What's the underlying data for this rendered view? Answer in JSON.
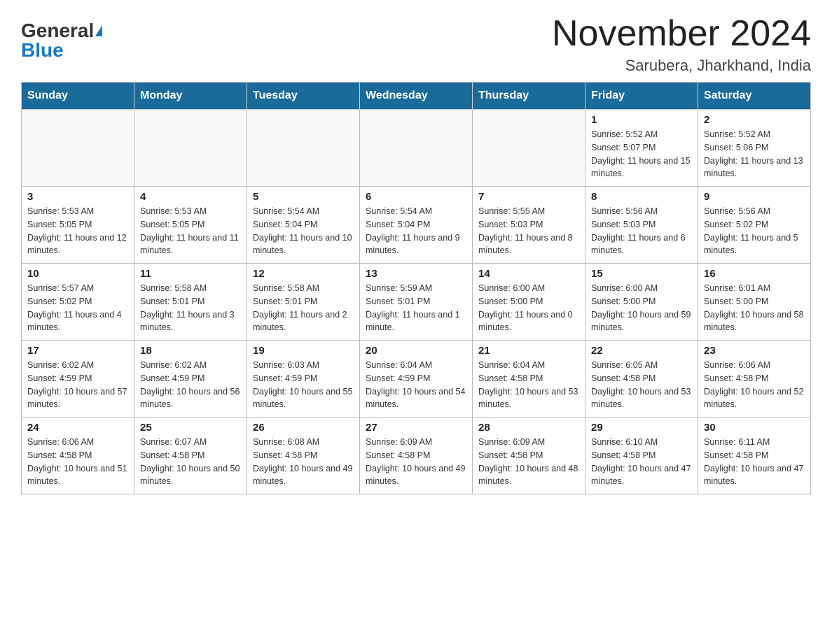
{
  "header": {
    "logo_general": "General",
    "logo_blue": "Blue",
    "month_title": "November 2024",
    "location": "Sarubera, Jharkhand, India"
  },
  "days_of_week": [
    "Sunday",
    "Monday",
    "Tuesday",
    "Wednesday",
    "Thursday",
    "Friday",
    "Saturday"
  ],
  "weeks": [
    [
      {
        "day": "",
        "info": ""
      },
      {
        "day": "",
        "info": ""
      },
      {
        "day": "",
        "info": ""
      },
      {
        "day": "",
        "info": ""
      },
      {
        "day": "",
        "info": ""
      },
      {
        "day": "1",
        "info": "Sunrise: 5:52 AM\nSunset: 5:07 PM\nDaylight: 11 hours and 15 minutes."
      },
      {
        "day": "2",
        "info": "Sunrise: 5:52 AM\nSunset: 5:06 PM\nDaylight: 11 hours and 13 minutes."
      }
    ],
    [
      {
        "day": "3",
        "info": "Sunrise: 5:53 AM\nSunset: 5:05 PM\nDaylight: 11 hours and 12 minutes."
      },
      {
        "day": "4",
        "info": "Sunrise: 5:53 AM\nSunset: 5:05 PM\nDaylight: 11 hours and 11 minutes."
      },
      {
        "day": "5",
        "info": "Sunrise: 5:54 AM\nSunset: 5:04 PM\nDaylight: 11 hours and 10 minutes."
      },
      {
        "day": "6",
        "info": "Sunrise: 5:54 AM\nSunset: 5:04 PM\nDaylight: 11 hours and 9 minutes."
      },
      {
        "day": "7",
        "info": "Sunrise: 5:55 AM\nSunset: 5:03 PM\nDaylight: 11 hours and 8 minutes."
      },
      {
        "day": "8",
        "info": "Sunrise: 5:56 AM\nSunset: 5:03 PM\nDaylight: 11 hours and 6 minutes."
      },
      {
        "day": "9",
        "info": "Sunrise: 5:56 AM\nSunset: 5:02 PM\nDaylight: 11 hours and 5 minutes."
      }
    ],
    [
      {
        "day": "10",
        "info": "Sunrise: 5:57 AM\nSunset: 5:02 PM\nDaylight: 11 hours and 4 minutes."
      },
      {
        "day": "11",
        "info": "Sunrise: 5:58 AM\nSunset: 5:01 PM\nDaylight: 11 hours and 3 minutes."
      },
      {
        "day": "12",
        "info": "Sunrise: 5:58 AM\nSunset: 5:01 PM\nDaylight: 11 hours and 2 minutes."
      },
      {
        "day": "13",
        "info": "Sunrise: 5:59 AM\nSunset: 5:01 PM\nDaylight: 11 hours and 1 minute."
      },
      {
        "day": "14",
        "info": "Sunrise: 6:00 AM\nSunset: 5:00 PM\nDaylight: 11 hours and 0 minutes."
      },
      {
        "day": "15",
        "info": "Sunrise: 6:00 AM\nSunset: 5:00 PM\nDaylight: 10 hours and 59 minutes."
      },
      {
        "day": "16",
        "info": "Sunrise: 6:01 AM\nSunset: 5:00 PM\nDaylight: 10 hours and 58 minutes."
      }
    ],
    [
      {
        "day": "17",
        "info": "Sunrise: 6:02 AM\nSunset: 4:59 PM\nDaylight: 10 hours and 57 minutes."
      },
      {
        "day": "18",
        "info": "Sunrise: 6:02 AM\nSunset: 4:59 PM\nDaylight: 10 hours and 56 minutes."
      },
      {
        "day": "19",
        "info": "Sunrise: 6:03 AM\nSunset: 4:59 PM\nDaylight: 10 hours and 55 minutes."
      },
      {
        "day": "20",
        "info": "Sunrise: 6:04 AM\nSunset: 4:59 PM\nDaylight: 10 hours and 54 minutes."
      },
      {
        "day": "21",
        "info": "Sunrise: 6:04 AM\nSunset: 4:58 PM\nDaylight: 10 hours and 53 minutes."
      },
      {
        "day": "22",
        "info": "Sunrise: 6:05 AM\nSunset: 4:58 PM\nDaylight: 10 hours and 53 minutes."
      },
      {
        "day": "23",
        "info": "Sunrise: 6:06 AM\nSunset: 4:58 PM\nDaylight: 10 hours and 52 minutes."
      }
    ],
    [
      {
        "day": "24",
        "info": "Sunrise: 6:06 AM\nSunset: 4:58 PM\nDaylight: 10 hours and 51 minutes."
      },
      {
        "day": "25",
        "info": "Sunrise: 6:07 AM\nSunset: 4:58 PM\nDaylight: 10 hours and 50 minutes."
      },
      {
        "day": "26",
        "info": "Sunrise: 6:08 AM\nSunset: 4:58 PM\nDaylight: 10 hours and 49 minutes."
      },
      {
        "day": "27",
        "info": "Sunrise: 6:09 AM\nSunset: 4:58 PM\nDaylight: 10 hours and 49 minutes."
      },
      {
        "day": "28",
        "info": "Sunrise: 6:09 AM\nSunset: 4:58 PM\nDaylight: 10 hours and 48 minutes."
      },
      {
        "day": "29",
        "info": "Sunrise: 6:10 AM\nSunset: 4:58 PM\nDaylight: 10 hours and 47 minutes."
      },
      {
        "day": "30",
        "info": "Sunrise: 6:11 AM\nSunset: 4:58 PM\nDaylight: 10 hours and 47 minutes."
      }
    ]
  ]
}
